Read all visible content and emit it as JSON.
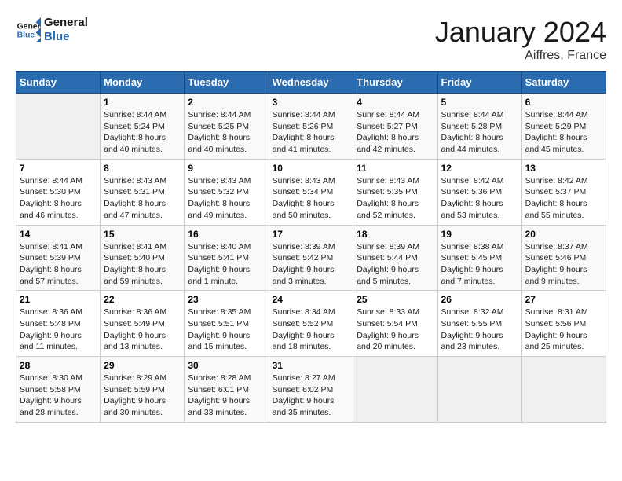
{
  "header": {
    "logo_line1": "General",
    "logo_line2": "Blue",
    "month_title": "January 2024",
    "location": "Aiffres, France"
  },
  "weekdays": [
    "Sunday",
    "Monday",
    "Tuesday",
    "Wednesday",
    "Thursday",
    "Friday",
    "Saturday"
  ],
  "weeks": [
    [
      {
        "day": "",
        "sunrise": "",
        "sunset": "",
        "daylight": ""
      },
      {
        "day": "1",
        "sunrise": "Sunrise: 8:44 AM",
        "sunset": "Sunset: 5:24 PM",
        "daylight": "Daylight: 8 hours and 40 minutes."
      },
      {
        "day": "2",
        "sunrise": "Sunrise: 8:44 AM",
        "sunset": "Sunset: 5:25 PM",
        "daylight": "Daylight: 8 hours and 40 minutes."
      },
      {
        "day": "3",
        "sunrise": "Sunrise: 8:44 AM",
        "sunset": "Sunset: 5:26 PM",
        "daylight": "Daylight: 8 hours and 41 minutes."
      },
      {
        "day": "4",
        "sunrise": "Sunrise: 8:44 AM",
        "sunset": "Sunset: 5:27 PM",
        "daylight": "Daylight: 8 hours and 42 minutes."
      },
      {
        "day": "5",
        "sunrise": "Sunrise: 8:44 AM",
        "sunset": "Sunset: 5:28 PM",
        "daylight": "Daylight: 8 hours and 44 minutes."
      },
      {
        "day": "6",
        "sunrise": "Sunrise: 8:44 AM",
        "sunset": "Sunset: 5:29 PM",
        "daylight": "Daylight: 8 hours and 45 minutes."
      }
    ],
    [
      {
        "day": "7",
        "sunrise": "Sunrise: 8:44 AM",
        "sunset": "Sunset: 5:30 PM",
        "daylight": "Daylight: 8 hours and 46 minutes."
      },
      {
        "day": "8",
        "sunrise": "Sunrise: 8:43 AM",
        "sunset": "Sunset: 5:31 PM",
        "daylight": "Daylight: 8 hours and 47 minutes."
      },
      {
        "day": "9",
        "sunrise": "Sunrise: 8:43 AM",
        "sunset": "Sunset: 5:32 PM",
        "daylight": "Daylight: 8 hours and 49 minutes."
      },
      {
        "day": "10",
        "sunrise": "Sunrise: 8:43 AM",
        "sunset": "Sunset: 5:34 PM",
        "daylight": "Daylight: 8 hours and 50 minutes."
      },
      {
        "day": "11",
        "sunrise": "Sunrise: 8:43 AM",
        "sunset": "Sunset: 5:35 PM",
        "daylight": "Daylight: 8 hours and 52 minutes."
      },
      {
        "day": "12",
        "sunrise": "Sunrise: 8:42 AM",
        "sunset": "Sunset: 5:36 PM",
        "daylight": "Daylight: 8 hours and 53 minutes."
      },
      {
        "day": "13",
        "sunrise": "Sunrise: 8:42 AM",
        "sunset": "Sunset: 5:37 PM",
        "daylight": "Daylight: 8 hours and 55 minutes."
      }
    ],
    [
      {
        "day": "14",
        "sunrise": "Sunrise: 8:41 AM",
        "sunset": "Sunset: 5:39 PM",
        "daylight": "Daylight: 8 hours and 57 minutes."
      },
      {
        "day": "15",
        "sunrise": "Sunrise: 8:41 AM",
        "sunset": "Sunset: 5:40 PM",
        "daylight": "Daylight: 8 hours and 59 minutes."
      },
      {
        "day": "16",
        "sunrise": "Sunrise: 8:40 AM",
        "sunset": "Sunset: 5:41 PM",
        "daylight": "Daylight: 9 hours and 1 minute."
      },
      {
        "day": "17",
        "sunrise": "Sunrise: 8:39 AM",
        "sunset": "Sunset: 5:42 PM",
        "daylight": "Daylight: 9 hours and 3 minutes."
      },
      {
        "day": "18",
        "sunrise": "Sunrise: 8:39 AM",
        "sunset": "Sunset: 5:44 PM",
        "daylight": "Daylight: 9 hours and 5 minutes."
      },
      {
        "day": "19",
        "sunrise": "Sunrise: 8:38 AM",
        "sunset": "Sunset: 5:45 PM",
        "daylight": "Daylight: 9 hours and 7 minutes."
      },
      {
        "day": "20",
        "sunrise": "Sunrise: 8:37 AM",
        "sunset": "Sunset: 5:46 PM",
        "daylight": "Daylight: 9 hours and 9 minutes."
      }
    ],
    [
      {
        "day": "21",
        "sunrise": "Sunrise: 8:36 AM",
        "sunset": "Sunset: 5:48 PM",
        "daylight": "Daylight: 9 hours and 11 minutes."
      },
      {
        "day": "22",
        "sunrise": "Sunrise: 8:36 AM",
        "sunset": "Sunset: 5:49 PM",
        "daylight": "Daylight: 9 hours and 13 minutes."
      },
      {
        "day": "23",
        "sunrise": "Sunrise: 8:35 AM",
        "sunset": "Sunset: 5:51 PM",
        "daylight": "Daylight: 9 hours and 15 minutes."
      },
      {
        "day": "24",
        "sunrise": "Sunrise: 8:34 AM",
        "sunset": "Sunset: 5:52 PM",
        "daylight": "Daylight: 9 hours and 18 minutes."
      },
      {
        "day": "25",
        "sunrise": "Sunrise: 8:33 AM",
        "sunset": "Sunset: 5:54 PM",
        "daylight": "Daylight: 9 hours and 20 minutes."
      },
      {
        "day": "26",
        "sunrise": "Sunrise: 8:32 AM",
        "sunset": "Sunset: 5:55 PM",
        "daylight": "Daylight: 9 hours and 23 minutes."
      },
      {
        "day": "27",
        "sunrise": "Sunrise: 8:31 AM",
        "sunset": "Sunset: 5:56 PM",
        "daylight": "Daylight: 9 hours and 25 minutes."
      }
    ],
    [
      {
        "day": "28",
        "sunrise": "Sunrise: 8:30 AM",
        "sunset": "Sunset: 5:58 PM",
        "daylight": "Daylight: 9 hours and 28 minutes."
      },
      {
        "day": "29",
        "sunrise": "Sunrise: 8:29 AM",
        "sunset": "Sunset: 5:59 PM",
        "daylight": "Daylight: 9 hours and 30 minutes."
      },
      {
        "day": "30",
        "sunrise": "Sunrise: 8:28 AM",
        "sunset": "Sunset: 6:01 PM",
        "daylight": "Daylight: 9 hours and 33 minutes."
      },
      {
        "day": "31",
        "sunrise": "Sunrise: 8:27 AM",
        "sunset": "Sunset: 6:02 PM",
        "daylight": "Daylight: 9 hours and 35 minutes."
      },
      {
        "day": "",
        "sunrise": "",
        "sunset": "",
        "daylight": ""
      },
      {
        "day": "",
        "sunrise": "",
        "sunset": "",
        "daylight": ""
      },
      {
        "day": "",
        "sunrise": "",
        "sunset": "",
        "daylight": ""
      }
    ]
  ]
}
